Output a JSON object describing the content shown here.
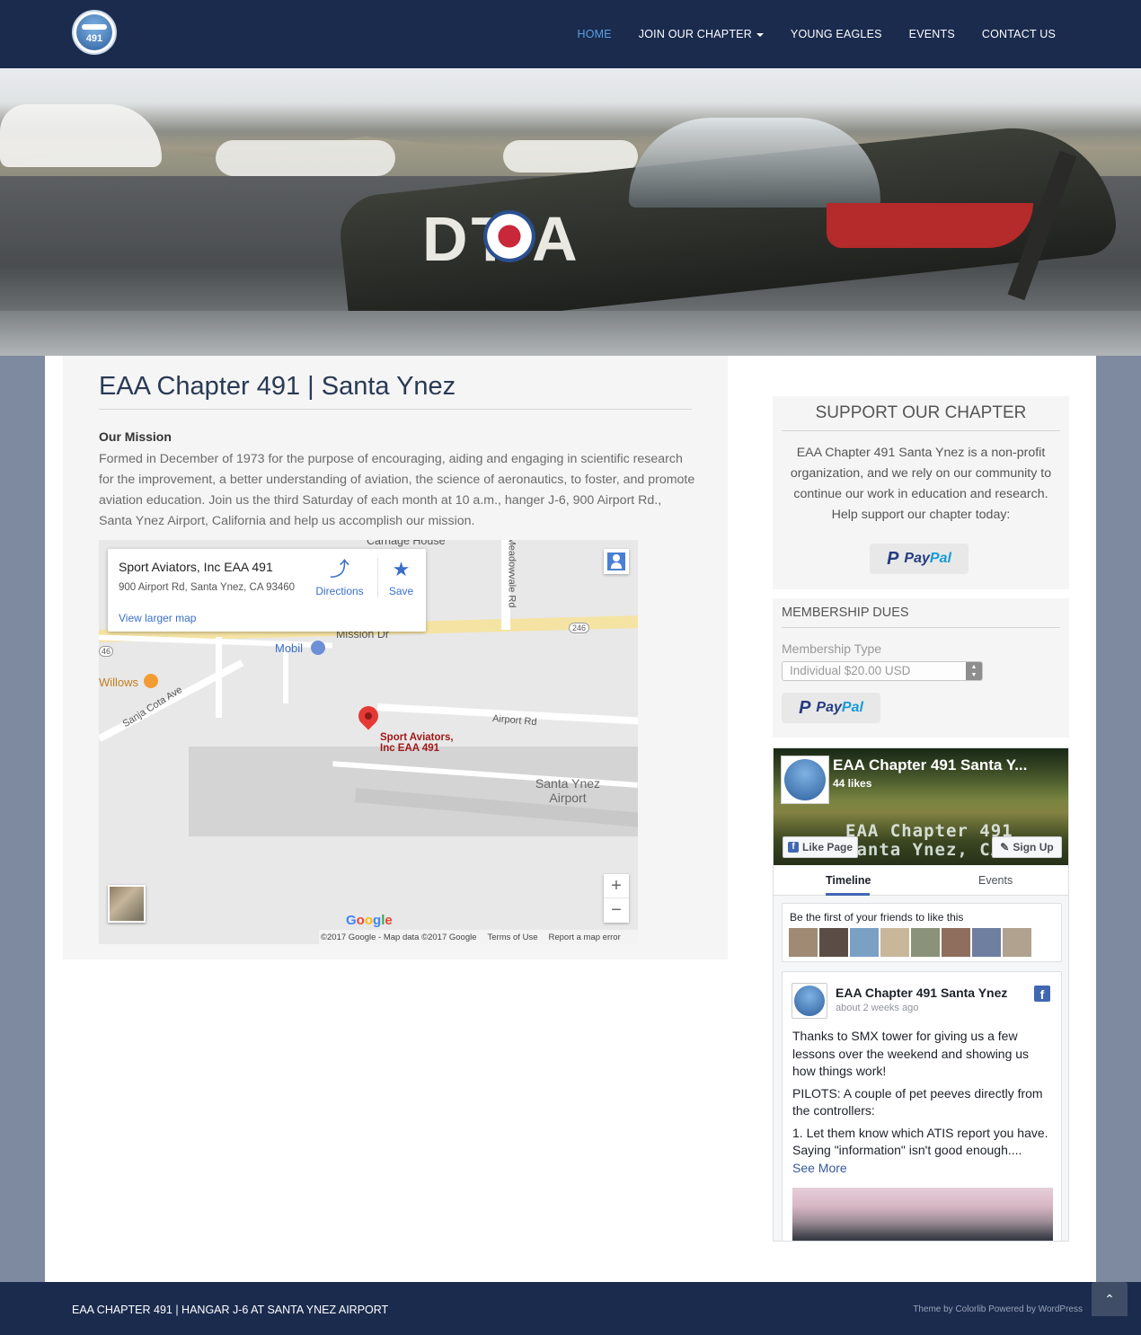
{
  "nav": {
    "logo_text": "491",
    "items": [
      {
        "label": "Home",
        "active": true
      },
      {
        "label": "Join Our Chapter",
        "dropdown": true
      },
      {
        "label": "Young Eagles"
      },
      {
        "label": "Events"
      },
      {
        "label": "Contact Us"
      }
    ]
  },
  "hero": {
    "plane_letters": "DT A"
  },
  "main": {
    "title": "EAA Chapter 491 | Santa Ynez",
    "mission_heading": "Our Mission",
    "mission_text": "Formed in December of 1973 for the purpose of encouraging, aiding and engaging in scientific research for the improvement, a better understanding of aviation, the science of aeronautics, to foster, and promote aviation education. Join us the third Saturday of each month at 10 a.m., hanger J-6, 900 Airport Rd., Santa Ynez Airport, California and help us accomplish our mission."
  },
  "map": {
    "place_name": "Sport Aviators, Inc EAA 491",
    "address": "900 Airport Rd, Santa Ynez, CA 93460",
    "directions_label": "Directions",
    "save_label": "Save",
    "larger_map_label": "View larger map",
    "marker_label_1": "Sport Aviators,",
    "marker_label_2": "Inc EAA 491",
    "labels": {
      "carriage_house": "Carriage House",
      "meadowvale": "Meadowvale Rd",
      "mission_dr": "Mission Dr",
      "mobil": "Mobil",
      "willows": "Willows",
      "sanja_cota": "Sanja Cota Ave",
      "airport_rd": "Airport Rd",
      "airport_1": "Santa Ynez",
      "airport_2": "Airport",
      "route_246_a": "246",
      "route_246_b": "46"
    },
    "google_logo": "Google",
    "footer_copy": "©2017 Google - Map data ©2017 Google",
    "footer_terms": "Terms of Use",
    "footer_report": "Report a map error",
    "zoom_in": "+",
    "zoom_out": "−"
  },
  "support": {
    "title": "SUPPORT OUR CHAPTER",
    "text": "EAA Chapter 491 Santa Ynez is a non-profit organization, and we rely on our community to continue our work in education and research. Help support our chapter today:",
    "paypal_a": "Pay",
    "paypal_b": "Pal"
  },
  "dues": {
    "title": "MEMBERSHIP DUES",
    "type_label": "Membership Type",
    "selected": "Individual $20.00 USD",
    "paypal_a": "Pay",
    "paypal_b": "Pal"
  },
  "facebook": {
    "page_name": "EAA Chapter 491 Santa Y...",
    "likes": "44 likes",
    "cover_line1": "EAA Chapter 491",
    "cover_line2": "Santa Ynez, CA",
    "like_btn": "Like Page",
    "signup_btn": "Sign Up",
    "tab_timeline": "Timeline",
    "tab_events": "Events",
    "friends_text": "Be the first of your friends to like this",
    "face_colors": [
      "#a08a74",
      "#5b4d45",
      "#7aa0c4",
      "#c9b79a",
      "#8a9279",
      "#8f6e5e",
      "#6e7fa0",
      "#b0a28f"
    ],
    "post_author": "EAA Chapter 491 Santa Ynez",
    "post_time": "about 2 weeks ago",
    "post_p1": "Thanks to SMX tower for giving us a few lessons over the weekend and showing us how things work!",
    "post_p2": "PILOTS: A couple of pet peeves directly from the controllers:",
    "post_p3": "1. Let them know which ATIS report you have. Saying \"information\" isn't good enough....",
    "see_more": "See More"
  },
  "footer": {
    "left_text": "EAA Chapter 491 | Hangar J-6 at Santa Ynez Airport",
    "right_text": "Theme by Colorlib Powered by WordPress",
    "to_top": "⌃"
  },
  "colors": {
    "nav_bg": "#1a2b4e",
    "active_link": "#5aa0e0",
    "page_bg": "#7d8aa0"
  }
}
